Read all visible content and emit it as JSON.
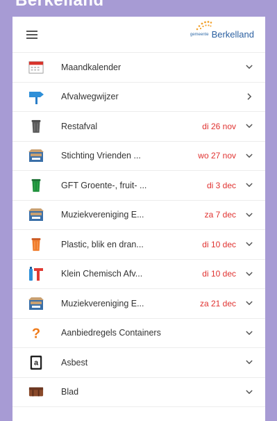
{
  "page": {
    "top_heading_fragment": "Berkelland",
    "background": "#a79bd4"
  },
  "header": {
    "logo_prefix": "gemeente",
    "logo_name": "Berkelland"
  },
  "colors": {
    "date": "#e0312f",
    "logo_blue": "#2a5fa0",
    "logo_orange": "#f2a12b"
  },
  "items": [
    {
      "label": "Maandkalender",
      "date": "",
      "icon": "calendar-icon",
      "chevron": "down"
    },
    {
      "label": "Afvalwegwijzer",
      "date": "",
      "icon": "signpost-icon",
      "chevron": "right"
    },
    {
      "label": "Restafval",
      "date": "di 26 nov",
      "icon": "grey-bin-icon",
      "chevron": "down"
    },
    {
      "label": "Stichting Vrienden ...",
      "date": "wo 27 nov",
      "icon": "paper-box-icon",
      "chevron": "down"
    },
    {
      "label": "GFT Groente-, fruit- ...",
      "date": "di 3 dec",
      "icon": "green-bin-icon",
      "chevron": "down"
    },
    {
      "label": "Muziekvereniging E...",
      "date": "za 7 dec",
      "icon": "paper-box-icon",
      "chevron": "down"
    },
    {
      "label": "Plastic, blik en dran...",
      "date": "di 10 dec",
      "icon": "orange-bin-icon",
      "chevron": "down"
    },
    {
      "label": "Klein Chemisch Afv...",
      "date": "di 10 dec",
      "icon": "chemical-icon",
      "chevron": "down"
    },
    {
      "label": "Muziekvereniging E...",
      "date": "za 21 dec",
      "icon": "paper-box-icon",
      "chevron": "down"
    },
    {
      "label": "Aanbiedregels Containers",
      "date": "",
      "icon": "question-icon",
      "chevron": "down"
    },
    {
      "label": "Asbest",
      "date": "",
      "icon": "asbestos-icon",
      "chevron": "down"
    },
    {
      "label": "Blad",
      "date": "",
      "icon": "leaves-icon",
      "chevron": "down"
    }
  ]
}
